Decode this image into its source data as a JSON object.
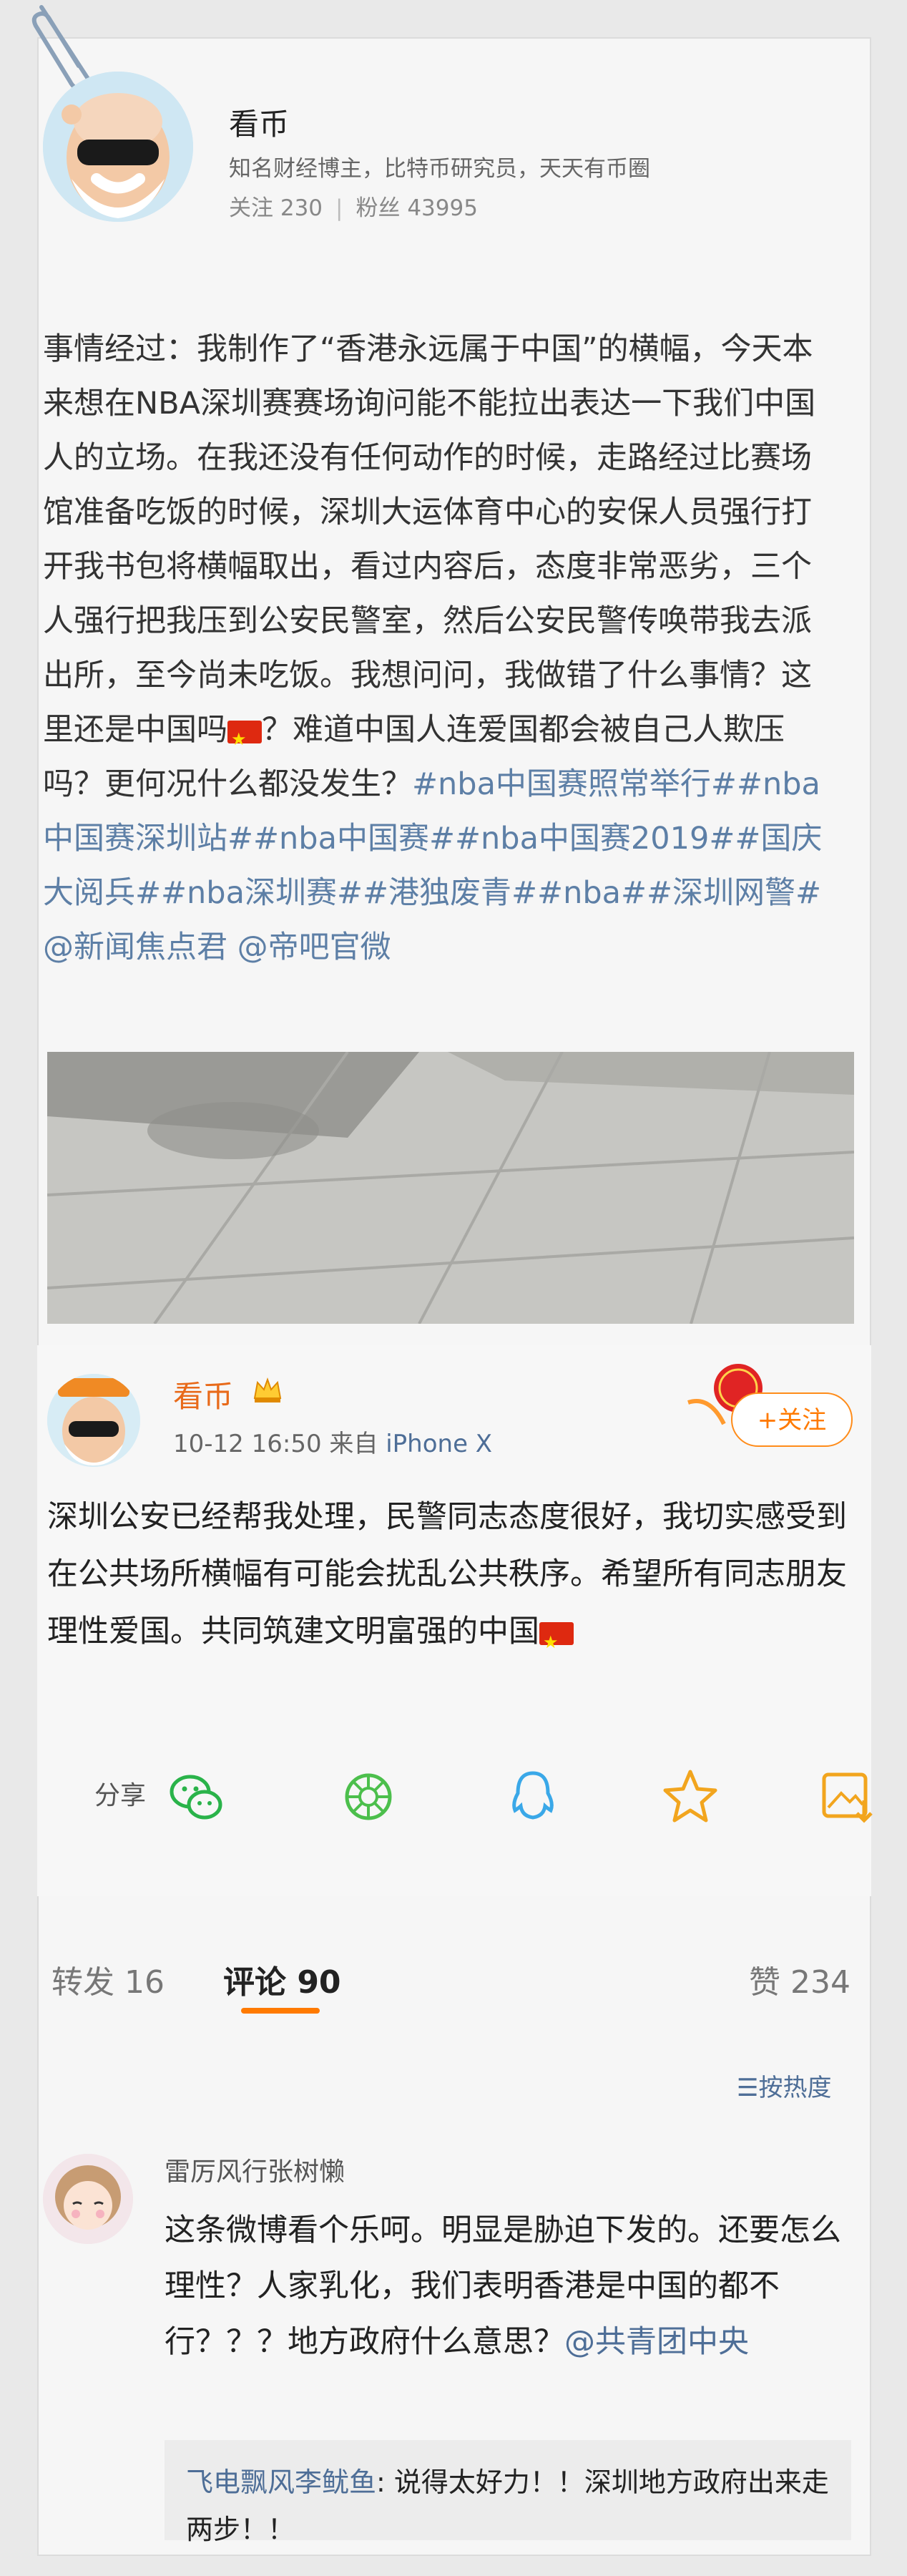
{
  "profile": {
    "name": "看币",
    "bio": "知名财经博主，比特币研究员，天天有币圈",
    "following_label": "关注 230",
    "followers_label": "粉丝 43995",
    "separator": "|"
  },
  "post": {
    "text": "事情经过：我制作了“香港永远属于中国”的横幅，今天本来想在NBA深圳赛赛场询问能不能拉出表达一下我们中国人的立场。在我还没有任何动作的时候，走路经过比赛场馆准备吃饭的时候，深圳大运体育中心的安保人员强行打开我书包将横幅取出，看过内容后，态度非常恶劣，三个人强行把我压到公安民警室，然后公安民警传唤带我去派出所，至今尚未吃饭。我想问问，我做错了什么事情？这里还是中国吗",
    "text_after_flag": "？难道中国人连爱国都会被自己人欺压吗？更何况什么都没发生？",
    "tags": "#nba中国赛照常举行##nba中国赛深圳站##nba中国赛##nba中国赛2019##国庆大阅兵##nba深圳赛##港独废青##nba##深圳网警# @新闻焦点君 @帝吧官微"
  },
  "embed": {
    "name": "看币",
    "time": "10-12 16:50",
    "source_prefix": "来自",
    "source": "iPhone X",
    "follow_label": "+关注",
    "text": "深圳公安已经帮我处理，民警同志态度很好，我切实感受到在公共场所横幅有可能会扰乱公共秩序。希望所有同志朋友理性爱国。共同筑建文明富强的中国",
    "share_label": "分享",
    "icons": [
      "wechat-icon",
      "moments-icon",
      "qq-icon",
      "favorite-star-icon",
      "save-image-icon"
    ]
  },
  "tabs": {
    "repost": "转发 16",
    "comments": "评论 90",
    "likes": "赞 234",
    "sort": "按热度"
  },
  "comment": {
    "name": "雷厉风行张树懒",
    "text": "这条微博看个乐呵。明显是胁迫下发的。还要怎么理性？人家乳化，我们表明香港是中国的都不行？？？地方政府什么意思？",
    "mention": "@共青团中央",
    "reply_name": "飞电飘风李鱿鱼",
    "reply_text": ": 说得太好力！！深圳地方政府出来走两步！！"
  },
  "colors": {
    "accent_orange": "#ff7a00",
    "link_blue": "#4e6e97",
    "tag_blue": "#5d7fa6"
  }
}
